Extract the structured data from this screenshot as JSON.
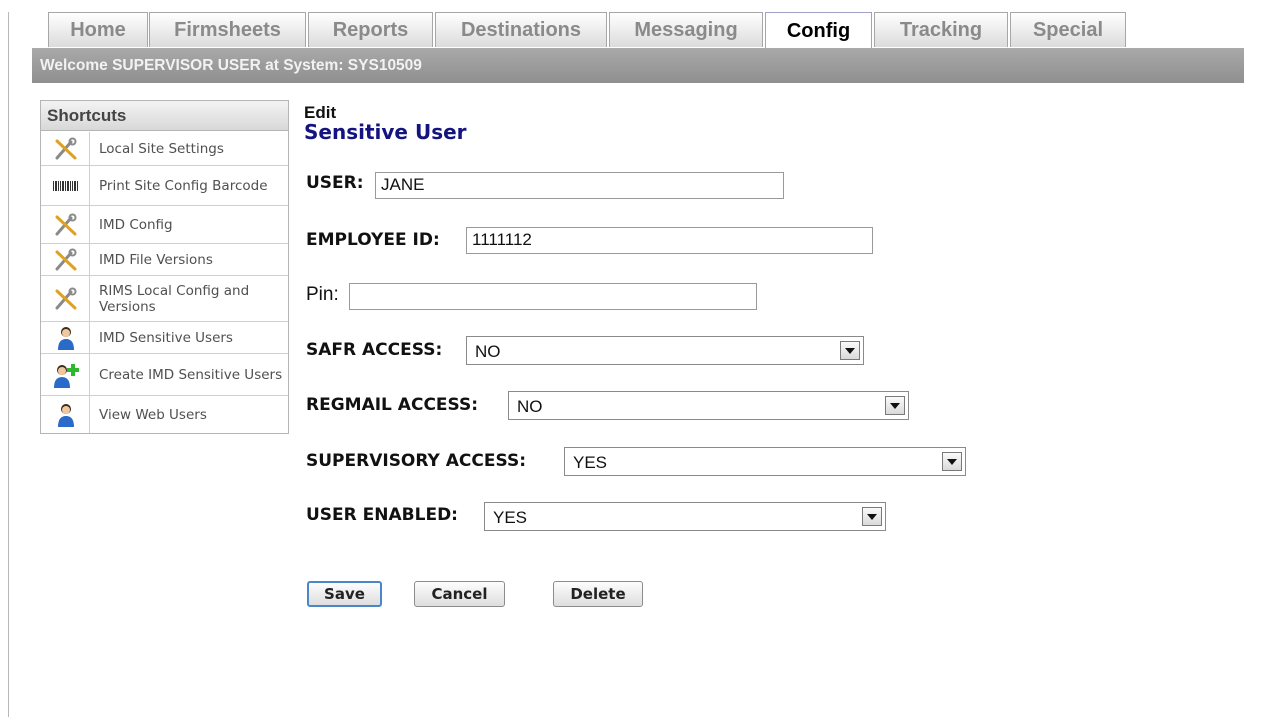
{
  "tabs": [
    {
      "label": "Home"
    },
    {
      "label": "Firmsheets"
    },
    {
      "label": "Reports"
    },
    {
      "label": "Destinations"
    },
    {
      "label": "Messaging"
    },
    {
      "label": "Config",
      "active": true
    },
    {
      "label": "Tracking"
    },
    {
      "label": "Special"
    }
  ],
  "banner": {
    "text": "Welcome SUPERVISOR USER at System: SYS10509"
  },
  "shortcuts": {
    "title": "Shortcuts",
    "items": [
      {
        "label": "Local Site Settings",
        "icon": "tools-icon"
      },
      {
        "label": "Print Site Config Barcode",
        "icon": "barcode-icon"
      },
      {
        "label": "IMD Config",
        "icon": "tools-icon"
      },
      {
        "label": "IMD File Versions",
        "icon": "tools-icon"
      },
      {
        "label": "RIMS Local Config and Versions",
        "icon": "tools-icon"
      },
      {
        "label": "IMD Sensitive Users",
        "icon": "user-icon"
      },
      {
        "label": "Create IMD Sensitive Users",
        "icon": "add-user-icon"
      },
      {
        "label": "View Web Users",
        "icon": "user-icon"
      }
    ]
  },
  "form": {
    "edit_label": "Edit",
    "title": "Sensitive User",
    "user": {
      "label": "USER:",
      "value": "JANE"
    },
    "employee_id": {
      "label": "EMPLOYEE ID:",
      "value": "1111112"
    },
    "pin": {
      "label": "Pin:",
      "value": ""
    },
    "safr_access": {
      "label": "SAFR ACCESS:",
      "value": "NO"
    },
    "regmail_access": {
      "label": "REGMAIL ACCESS:",
      "value": "NO"
    },
    "supervisory_access": {
      "label": "SUPERVISORY ACCESS:",
      "value": "YES"
    },
    "user_enabled": {
      "label": "USER ENABLED:",
      "value": "YES"
    }
  },
  "buttons": {
    "save": "Save",
    "cancel": "Cancel",
    "delete": "Delete"
  }
}
